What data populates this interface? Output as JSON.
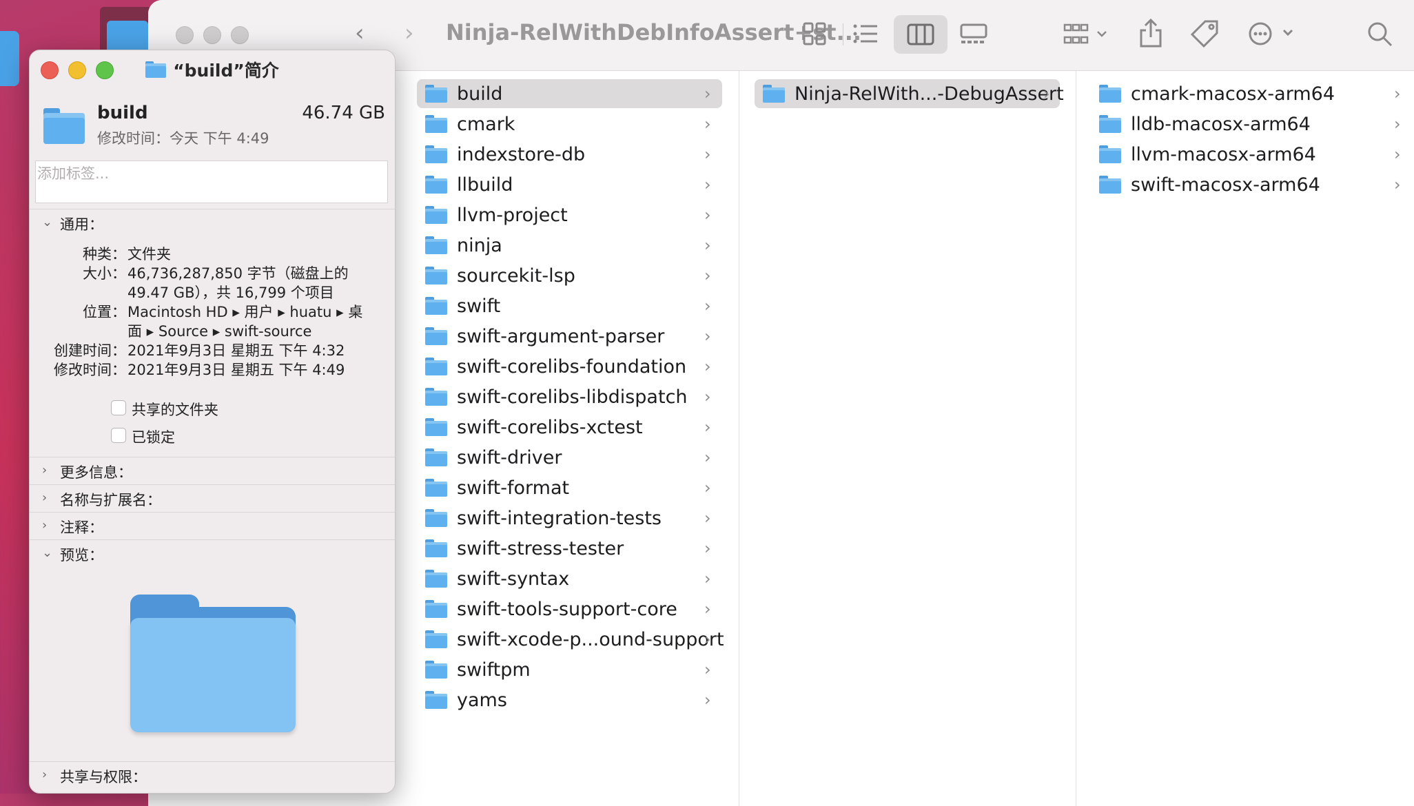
{
  "finder": {
    "title": "Ninja-RelWithDebInfoAssert+st...",
    "toolbar_icons": [
      "back-icon",
      "forward-icon",
      "icon-view-icon",
      "list-view-icon",
      "column-view-icon",
      "gallery-view-icon",
      "group-icon",
      "share-icon",
      "tag-icon",
      "more-icon",
      "search-icon"
    ],
    "column1": [
      {
        "name": "build",
        "selected": true
      },
      {
        "name": "cmark"
      },
      {
        "name": "indexstore-db"
      },
      {
        "name": "llbuild"
      },
      {
        "name": "llvm-project"
      },
      {
        "name": "ninja"
      },
      {
        "name": "sourcekit-lsp"
      },
      {
        "name": "swift"
      },
      {
        "name": "swift-argument-parser"
      },
      {
        "name": "swift-corelibs-foundation"
      },
      {
        "name": "swift-corelibs-libdispatch"
      },
      {
        "name": "swift-corelibs-xctest"
      },
      {
        "name": "swift-driver"
      },
      {
        "name": "swift-format"
      },
      {
        "name": "swift-integration-tests"
      },
      {
        "name": "swift-stress-tester"
      },
      {
        "name": "swift-syntax"
      },
      {
        "name": "swift-tools-support-core"
      },
      {
        "name": "swift-xcode-p...ound-support"
      },
      {
        "name": "swiftpm"
      },
      {
        "name": "yams"
      }
    ],
    "column2": [
      {
        "name": "Ninja-RelWith...-DebugAssert",
        "selected": true
      }
    ],
    "column3": [
      {
        "name": "cmark-macosx-arm64"
      },
      {
        "name": "lldb-macosx-arm64"
      },
      {
        "name": "llvm-macosx-arm64"
      },
      {
        "name": "swift-macosx-arm64"
      }
    ],
    "chevron": "›"
  },
  "info": {
    "title": "“build”简介",
    "name": "build",
    "size_header": "46.74 GB",
    "modified_header": "修改时间：今天 下午 4:49",
    "tag_placeholder": "添加标签...",
    "general_label": "通用：",
    "kind_label": "种类：",
    "kind_value": "文件夹",
    "size_label": "大小：",
    "size_value_1": "46,736,287,850 字节（磁盘上的",
    "size_value_2": "49.47 GB），共 16,799 个项目",
    "where_label": "位置：",
    "where_value_1": "Macintosh HD ▸ 用户 ▸ huatu ▸ 桌",
    "where_value_2": "面 ▸ Source ▸ swift-source",
    "created_label": "创建时间：",
    "created_value": "2021年9月3日 星期五 下午 4:32",
    "modified_label": "修改时间：",
    "modified_value": "2021年9月3日 星期五 下午 4:49",
    "shared_folder": "共享的文件夹",
    "locked": "已锁定",
    "more_info": "更多信息：",
    "name_ext": "名称与扩展名：",
    "comments": "注释：",
    "preview": "预览：",
    "sharing": "共享与权限："
  },
  "colors": {
    "close": "#ec5f56",
    "minimize": "#f2bf2f",
    "zoom": "#5fc44a",
    "folder": "#5fb0ef"
  }
}
